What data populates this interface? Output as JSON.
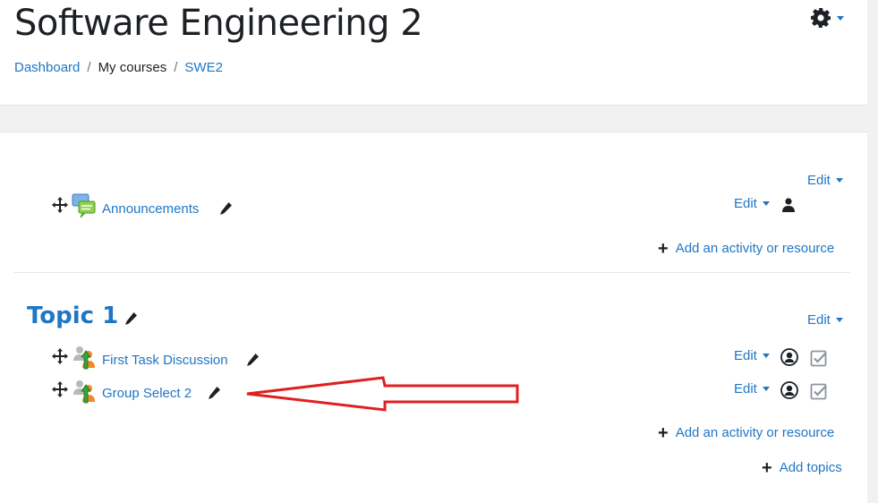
{
  "header": {
    "title": "Software Engineering 2",
    "breadcrumb": [
      "Dashboard",
      "My courses",
      "SWE2"
    ],
    "breadcrumb_separator": "/"
  },
  "general_section": {
    "edit_label": "Edit",
    "activities": [
      {
        "name": "Announcements",
        "icon": "forum-icon",
        "edit_label": "Edit"
      }
    ],
    "add_activity_label": "Add an activity or resource"
  },
  "topic1": {
    "title": "Topic 1",
    "edit_label": "Edit",
    "activities": [
      {
        "name": "First Task Discussion",
        "icon": "group-choice-icon",
        "edit_label": "Edit"
      },
      {
        "name": "Group Select 2",
        "icon": "group-choice-icon",
        "edit_label": "Edit"
      }
    ],
    "add_activity_label": "Add an activity or resource",
    "add_topics_label": "Add topics"
  },
  "colors": {
    "link": "#1f76c5",
    "annotation_arrow": "#e02020"
  }
}
